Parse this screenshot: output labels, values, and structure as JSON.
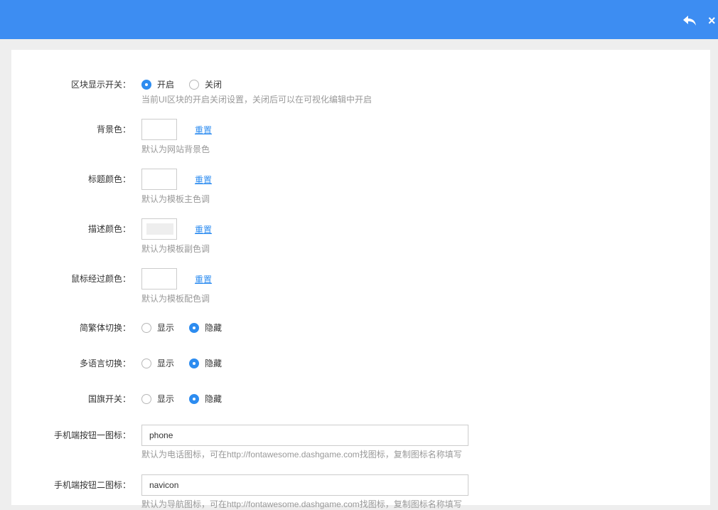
{
  "header": {
    "back_icon": "reply-icon",
    "close_label": "×"
  },
  "form": {
    "block_switch": {
      "label": "区块显示开关：",
      "options": [
        "开启",
        "关闭"
      ],
      "selected": "开启",
      "hint": "当前UI区块的开启关闭设置，关闭后可以在可视化编辑中开启"
    },
    "bg_color": {
      "label": "背景色：",
      "reset": "重置",
      "hint": "默认为网站背景色"
    },
    "title_color": {
      "label": "标题颜色：",
      "reset": "重置",
      "hint": "默认为模板主色调"
    },
    "desc_color": {
      "label": "描述颜色：",
      "reset": "重置",
      "hint": "默认为模板副色调",
      "value": "#eeeeee"
    },
    "hover_color": {
      "label": "鼠标经过颜色：",
      "reset": "重置",
      "hint": "默认为模板配色调"
    },
    "trad_switch": {
      "label": "简繁体切换：",
      "options": [
        "显示",
        "隐藏"
      ],
      "selected": "隐藏"
    },
    "lang_switch": {
      "label": "多语言切换：",
      "options": [
        "显示",
        "隐藏"
      ],
      "selected": "隐藏"
    },
    "flag_switch": {
      "label": "国旗开关：",
      "options": [
        "显示",
        "隐藏"
      ],
      "selected": "隐藏"
    },
    "mobile_icon1": {
      "label": "手机端按钮一图标：",
      "value": "phone",
      "hint": "默认为电话图标，可在http://fontawesome.dashgame.com找图标，复制图标名称填写"
    },
    "mobile_icon2": {
      "label": "手机端按钮二图标：",
      "value": "navicon",
      "hint": "默认为导航图标，可在http://fontawesome.dashgame.com找图标，复制图标名称填写"
    }
  }
}
